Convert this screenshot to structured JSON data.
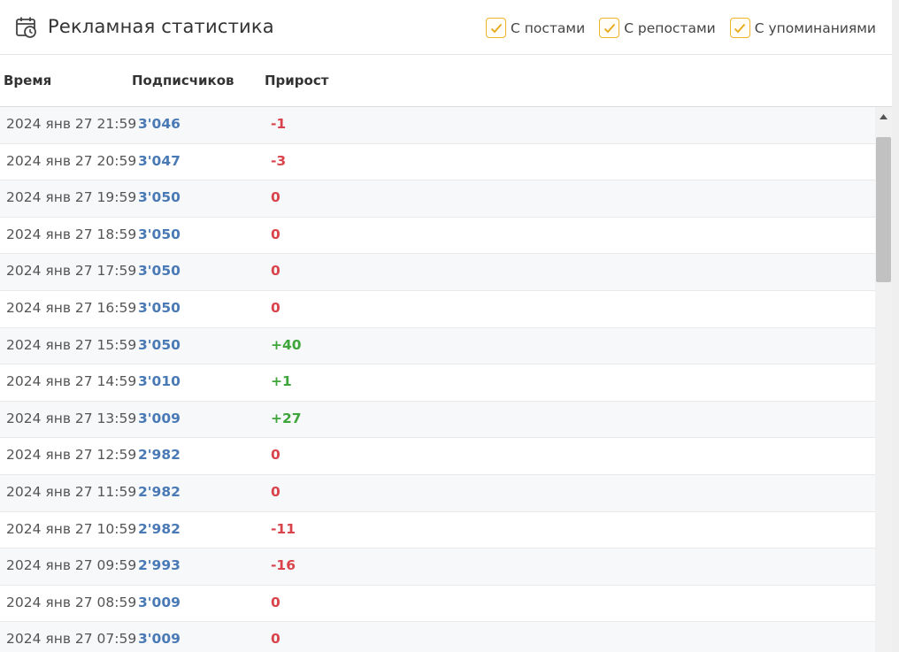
{
  "header": {
    "title": "Рекламная статистика",
    "icon": "calendar-clock-icon",
    "filters": [
      {
        "label": "С постами",
        "checked": true
      },
      {
        "label": "С репостами",
        "checked": true
      },
      {
        "label": "С упоминаниями",
        "checked": true
      }
    ]
  },
  "columns": {
    "time": "Время",
    "subscribers": "Подписчиков",
    "growth": "Прирост"
  },
  "colors": {
    "accent_checkbox": "#f0b429",
    "subscribers": "#4a7ab5",
    "negative": "#d9434b",
    "positive": "#3ea53a"
  },
  "rows": [
    {
      "time": "2024 янв 27 21:59",
      "subscribers": "3'046",
      "growth": "-1"
    },
    {
      "time": "2024 янв 27 20:59",
      "subscribers": "3'047",
      "growth": "-3"
    },
    {
      "time": "2024 янв 27 19:59",
      "subscribers": "3'050",
      "growth": "0"
    },
    {
      "time": "2024 янв 27 18:59",
      "subscribers": "3'050",
      "growth": "0"
    },
    {
      "time": "2024 янв 27 17:59",
      "subscribers": "3'050",
      "growth": "0"
    },
    {
      "time": "2024 янв 27 16:59",
      "subscribers": "3'050",
      "growth": "0"
    },
    {
      "time": "2024 янв 27 15:59",
      "subscribers": "3'050",
      "growth": "+40"
    },
    {
      "time": "2024 янв 27 14:59",
      "subscribers": "3'010",
      "growth": "+1"
    },
    {
      "time": "2024 янв 27 13:59",
      "subscribers": "3'009",
      "growth": "+27"
    },
    {
      "time": "2024 янв 27 12:59",
      "subscribers": "2'982",
      "growth": "0"
    },
    {
      "time": "2024 янв 27 11:59",
      "subscribers": "2'982",
      "growth": "0"
    },
    {
      "time": "2024 янв 27 10:59",
      "subscribers": "2'982",
      "growth": "-11"
    },
    {
      "time": "2024 янв 27 09:59",
      "subscribers": "2'993",
      "growth": "-16"
    },
    {
      "time": "2024 янв 27 08:59",
      "subscribers": "3'009",
      "growth": "0"
    },
    {
      "time": "2024 янв 27 07:59",
      "subscribers": "3'009",
      "growth": "0"
    }
  ]
}
